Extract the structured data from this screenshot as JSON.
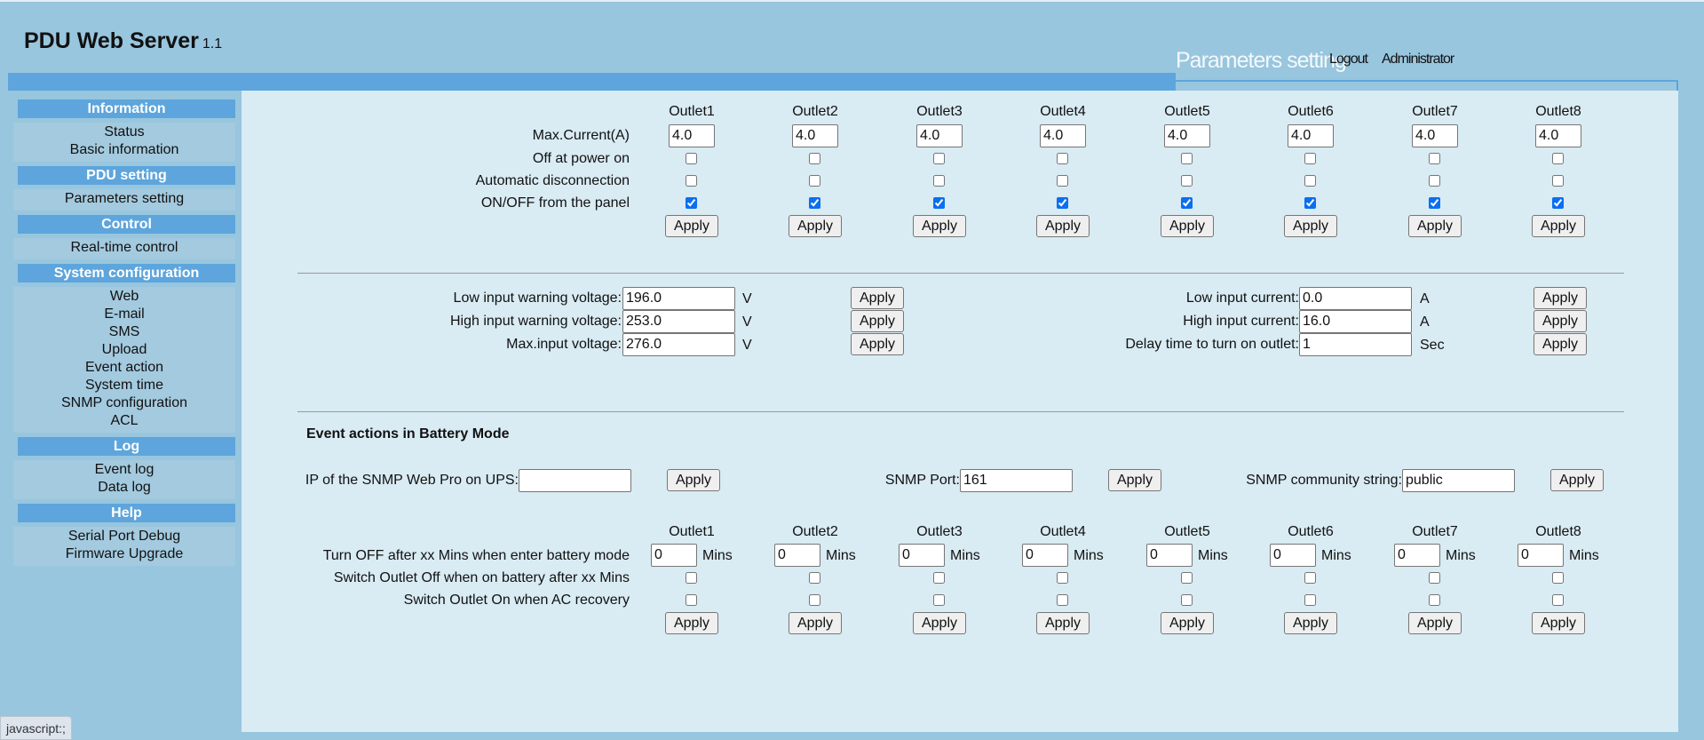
{
  "header": {
    "title": "PDU Web Server",
    "version": "1.1",
    "active_tab": "Parameters setting",
    "logout": "Logout",
    "user": "Administrator"
  },
  "sidebar": {
    "groups": [
      {
        "title": "Information",
        "items": [
          "Status",
          "Basic information"
        ]
      },
      {
        "title": "PDU setting",
        "items": [
          "Parameters setting"
        ]
      },
      {
        "title": "Control",
        "items": [
          "Real-time control"
        ]
      },
      {
        "title": "System configuration",
        "items": [
          "Web",
          "E-mail",
          "SMS",
          "Upload",
          "Event action",
          "System time",
          "SNMP configuration",
          "ACL"
        ]
      },
      {
        "title": "Log",
        "items": [
          "Event log",
          "Data log"
        ]
      },
      {
        "title": "Help",
        "items": [
          "Serial Port Debug",
          "Firmware Upgrade"
        ]
      }
    ]
  },
  "outlets": {
    "headers": [
      "Outlet1",
      "Outlet2",
      "Outlet3",
      "Outlet4",
      "Outlet5",
      "Outlet6",
      "Outlet7",
      "Outlet8"
    ],
    "row_labels": {
      "max_current": "Max.Current(A)",
      "off_at_power_on": "Off at power on",
      "auto_disconnect": "Automatic disconnection",
      "onoff_panel": "ON/OFF from the panel"
    },
    "max_current": [
      "4.0",
      "4.0",
      "4.0",
      "4.0",
      "4.0",
      "4.0",
      "4.0",
      "4.0"
    ],
    "off_at_power_on": [
      false,
      false,
      false,
      false,
      false,
      false,
      false,
      false
    ],
    "auto_disconnect": [
      false,
      false,
      false,
      false,
      false,
      false,
      false,
      false
    ],
    "onoff_panel": [
      true,
      true,
      true,
      true,
      true,
      true,
      true,
      true
    ],
    "apply_label": "Apply"
  },
  "input_settings": {
    "left": [
      {
        "label": "Low input warning voltage:",
        "value": "196.0",
        "unit": "V"
      },
      {
        "label": "High input warning voltage:",
        "value": "253.0",
        "unit": "V"
      },
      {
        "label": "Max.input voltage:",
        "value": "276.0",
        "unit": "V"
      }
    ],
    "right": [
      {
        "label": "Low input current:",
        "value": "0.0",
        "unit": "A"
      },
      {
        "label": "High input current:",
        "value": "16.0",
        "unit": "A"
      },
      {
        "label": "Delay time to turn on outlet:",
        "value": "1",
        "unit": "Sec"
      }
    ],
    "apply_label": "Apply"
  },
  "battery": {
    "title": "Event actions in Battery Mode",
    "snmp_ip_label": "IP of the SNMP Web Pro on UPS:",
    "snmp_ip_value": "",
    "snmp_port_label": "SNMP Port:",
    "snmp_port_value": "161",
    "snmp_community_label": "SNMP community string:",
    "snmp_community_value": "public",
    "apply_label": "Apply",
    "headers": [
      "Outlet1",
      "Outlet2",
      "Outlet3",
      "Outlet4",
      "Outlet5",
      "Outlet6",
      "Outlet7",
      "Outlet8"
    ],
    "row_labels": {
      "turn_off_mins": "Turn OFF after xx Mins when enter battery mode",
      "switch_off": "Switch Outlet Off when on battery after xx Mins",
      "switch_on": "Switch Outlet On when AC recovery"
    },
    "mins_unit": "Mins",
    "turn_off_mins": [
      "0",
      "0",
      "0",
      "0",
      "0",
      "0",
      "0",
      "0"
    ],
    "switch_off": [
      false,
      false,
      false,
      false,
      false,
      false,
      false,
      false
    ],
    "switch_on": [
      false,
      false,
      false,
      false,
      false,
      false,
      false,
      false
    ]
  },
  "status_bar": {
    "text": "javascript:;"
  },
  "colors": {
    "accent": "#5da5dc",
    "background": "#98c6de",
    "panel": "#d9ebf3",
    "checkbox": "#0a6ff0"
  }
}
